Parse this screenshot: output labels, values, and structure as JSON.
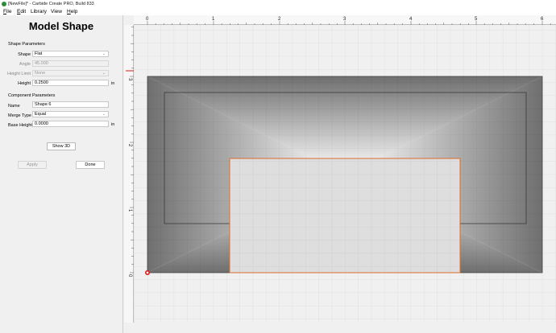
{
  "window": {
    "title": "[NewFile]* - Carbide Create PRO, Build 833"
  },
  "menu": [
    {
      "key": "F",
      "rest": "ile"
    },
    {
      "key": "E",
      "rest": "dit"
    },
    {
      "key": "",
      "rest": "Library"
    },
    {
      "key": "",
      "rest": "View"
    },
    {
      "key": "H",
      "rest": "elp"
    }
  ],
  "panel": {
    "title": "Model Shape",
    "shape_params": {
      "heading": "Shape Parameters",
      "shape_label": "Shape",
      "shape_value": "Flat",
      "angle_label": "Angle",
      "angle_value": "45.000",
      "height_limit_label": "Height Limit",
      "height_limit_value": "None",
      "height_label": "Height",
      "height_value": "0.2500",
      "height_unit": "in"
    },
    "component_params": {
      "heading": "Component Parameters",
      "name_label": "Name",
      "name_value": "Shape 6",
      "merge_label": "Merge Type",
      "merge_value": "Equal",
      "base_height_label": "Base Height",
      "base_height_value": "0.0000",
      "base_height_unit": "in"
    },
    "show3d_label": "Show 3D",
    "apply_label": "Apply",
    "done_label": "Done"
  },
  "rulers": {
    "x_labels": [
      "0",
      "1",
      "2",
      "3",
      "4",
      "5",
      "6"
    ],
    "y_labels": [
      "0",
      "1",
      "2",
      "3"
    ]
  },
  "colors": {
    "shape_dark": "#6f6f6f",
    "shape_light": "#ffffff",
    "selection_outline": "#e06a2b",
    "canvas_bg": "#f0f0f0",
    "origin_marker": "#e01818"
  }
}
